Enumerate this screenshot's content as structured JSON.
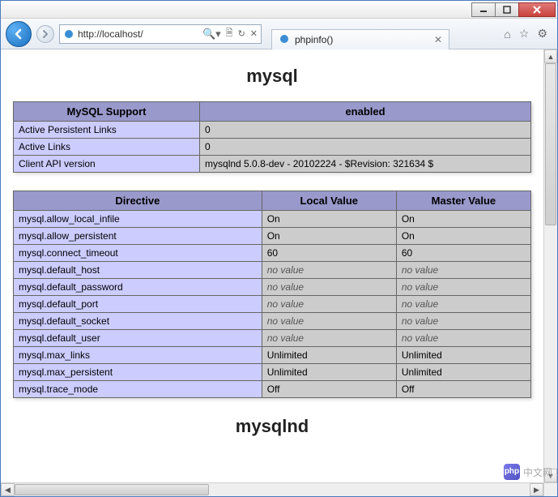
{
  "browser": {
    "url": "http://localhost/",
    "tab_title": "phpinfo()",
    "tools": {
      "home": "⌂",
      "star": "☆",
      "gear": "⚙"
    }
  },
  "page": {
    "module1_title": "mysql",
    "module2_title": "mysqlnd",
    "support_table": {
      "header_left": "MySQL Support",
      "header_right": "enabled",
      "rows": [
        {
          "name": "Active Persistent Links",
          "value": "0"
        },
        {
          "name": "Active Links",
          "value": "0"
        },
        {
          "name": "Client API version",
          "value": "mysqlnd 5.0.8-dev - 20102224 - $Revision: 321634 $"
        }
      ]
    },
    "directive_table": {
      "headers": {
        "c0": "Directive",
        "c1": "Local Value",
        "c2": "Master Value"
      },
      "rows": [
        {
          "name": "mysql.allow_local_infile",
          "local": "On",
          "master": "On",
          "italic": false
        },
        {
          "name": "mysql.allow_persistent",
          "local": "On",
          "master": "On",
          "italic": false
        },
        {
          "name": "mysql.connect_timeout",
          "local": "60",
          "master": "60",
          "italic": false
        },
        {
          "name": "mysql.default_host",
          "local": "no value",
          "master": "no value",
          "italic": true
        },
        {
          "name": "mysql.default_password",
          "local": "no value",
          "master": "no value",
          "italic": true
        },
        {
          "name": "mysql.default_port",
          "local": "no value",
          "master": "no value",
          "italic": true
        },
        {
          "name": "mysql.default_socket",
          "local": "no value",
          "master": "no value",
          "italic": true
        },
        {
          "name": "mysql.default_user",
          "local": "no value",
          "master": "no value",
          "italic": true
        },
        {
          "name": "mysql.max_links",
          "local": "Unlimited",
          "master": "Unlimited",
          "italic": false
        },
        {
          "name": "mysql.max_persistent",
          "local": "Unlimited",
          "master": "Unlimited",
          "italic": false
        },
        {
          "name": "mysql.trace_mode",
          "local": "Off",
          "master": "Off",
          "italic": false
        }
      ]
    }
  },
  "watermark": {
    "logo": "php",
    "text": "中文网"
  }
}
